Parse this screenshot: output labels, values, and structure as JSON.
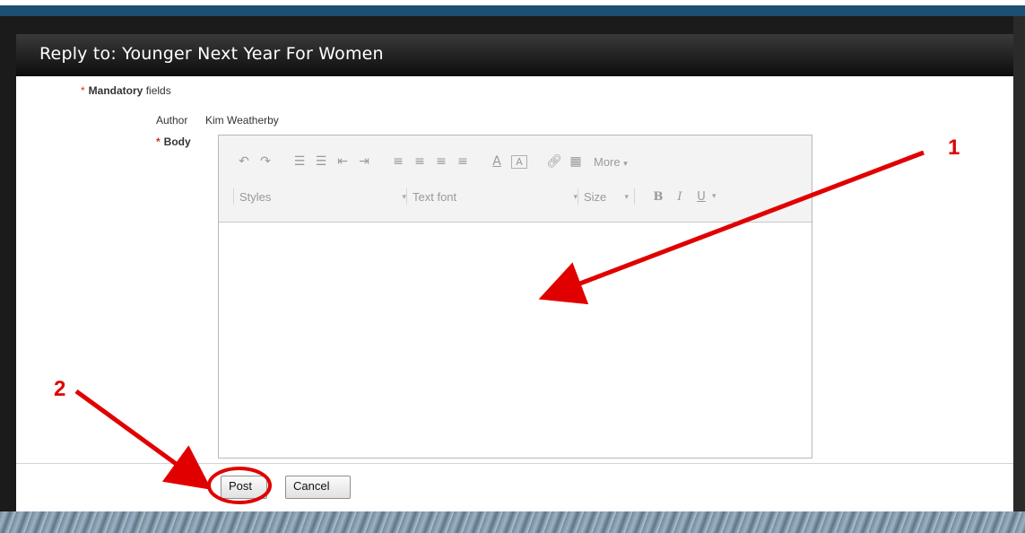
{
  "dialog": {
    "title": "Reply to: Younger Next Year For Women",
    "mandatory_star": "*",
    "mandatory_bold": "Mandatory",
    "mandatory_rest": " fields",
    "author_label": "Author",
    "author_value": "Kim Weatherby",
    "body_star": "*",
    "body_label": "Body"
  },
  "toolbar": {
    "row1_icons": [
      "undo-icon",
      "redo-icon",
      "numbered-list-icon",
      "bulleted-list-icon",
      "decrease-indent-icon",
      "increase-indent-icon",
      "align-left-icon",
      "align-center-icon",
      "align-right-icon",
      "justify-icon",
      "text-color-icon",
      "background-color-icon",
      "link-icon",
      "table-icon"
    ],
    "more_label": "More",
    "styles_label": "Styles",
    "font_label": "Text font",
    "size_label": "Size",
    "bold_label": "B",
    "italic_label": "I",
    "underline_label": "U"
  },
  "buttons": {
    "post": "Post",
    "cancel": "Cancel"
  },
  "annotations": {
    "label_1": "1",
    "label_2": "2",
    "color": "#e00000"
  },
  "colors": {
    "title_bar": "#0c0c0c",
    "frame": "#1b1b1b",
    "top_bar": "#1d4f73",
    "required_star": "#d2322d"
  }
}
